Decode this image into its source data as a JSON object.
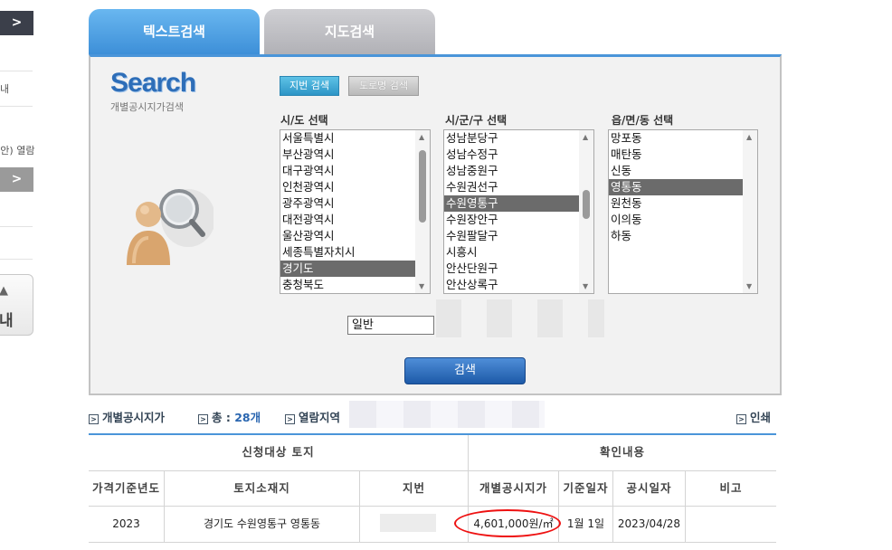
{
  "sidebar": {
    "arrow_label": ">",
    "text_1": "내",
    "text_2": "(안) 열람",
    "arrow_label_2": ">",
    "box_label": "내"
  },
  "tabs": [
    {
      "label": "텍스트검색"
    },
    {
      "label": "지도검색"
    }
  ],
  "panel": {
    "logo": "Search",
    "logo_sub": "개별공시지가검색",
    "btn_jibun": "지번 검색",
    "btn_road": "도로명 검색",
    "sido_label": "시/도 선택",
    "sigungu_label": "시/군/구 선택",
    "dong_label": "읍/면/동 선택",
    "sido_options": [
      "서울특별시",
      "부산광역시",
      "대구광역시",
      "인천광역시",
      "광주광역시",
      "대전광역시",
      "울산광역시",
      "세종특별자치시",
      "경기도",
      "충청북도"
    ],
    "sido_selected": 8,
    "sigungu_options": [
      "성남분당구",
      "성남수정구",
      "성남중원구",
      "수원권선구",
      "수원영통구",
      "수원장안구",
      "수원팔달구",
      "시흥시",
      "안산단원구",
      "안산상록구"
    ],
    "sigungu_selected": 4,
    "dong_options": [
      "망포동",
      "매탄동",
      "신동",
      "영통동",
      "원천동",
      "이의동",
      "하동"
    ],
    "dong_selected": 3,
    "land_type_value": "일반",
    "search_button": "검색"
  },
  "info": {
    "title": "개별공시지가",
    "total_label": "총 :",
    "total_value": "28개",
    "region_label": "열람지역",
    "print_label": "인쇄"
  },
  "table": {
    "group_left": "신청대상 토지",
    "group_right": "확인내용",
    "headers": [
      "가격기준년도",
      "토지소재지",
      "지번",
      "개별공시지가",
      "기준일자",
      "공시일자",
      "비고"
    ],
    "rows": [
      {
        "year": "2023",
        "location": "경기도 수원영통구 영통동",
        "jibun": "",
        "price": "4,601,000원/㎡",
        "base_date": "1월 1일",
        "announce_date": "2023/04/28",
        "note": ""
      }
    ]
  },
  "colors": {
    "accent_blue": "#3d8fd8",
    "selected_gray": "#6b6b6b",
    "highlight_red": "#e11111"
  }
}
